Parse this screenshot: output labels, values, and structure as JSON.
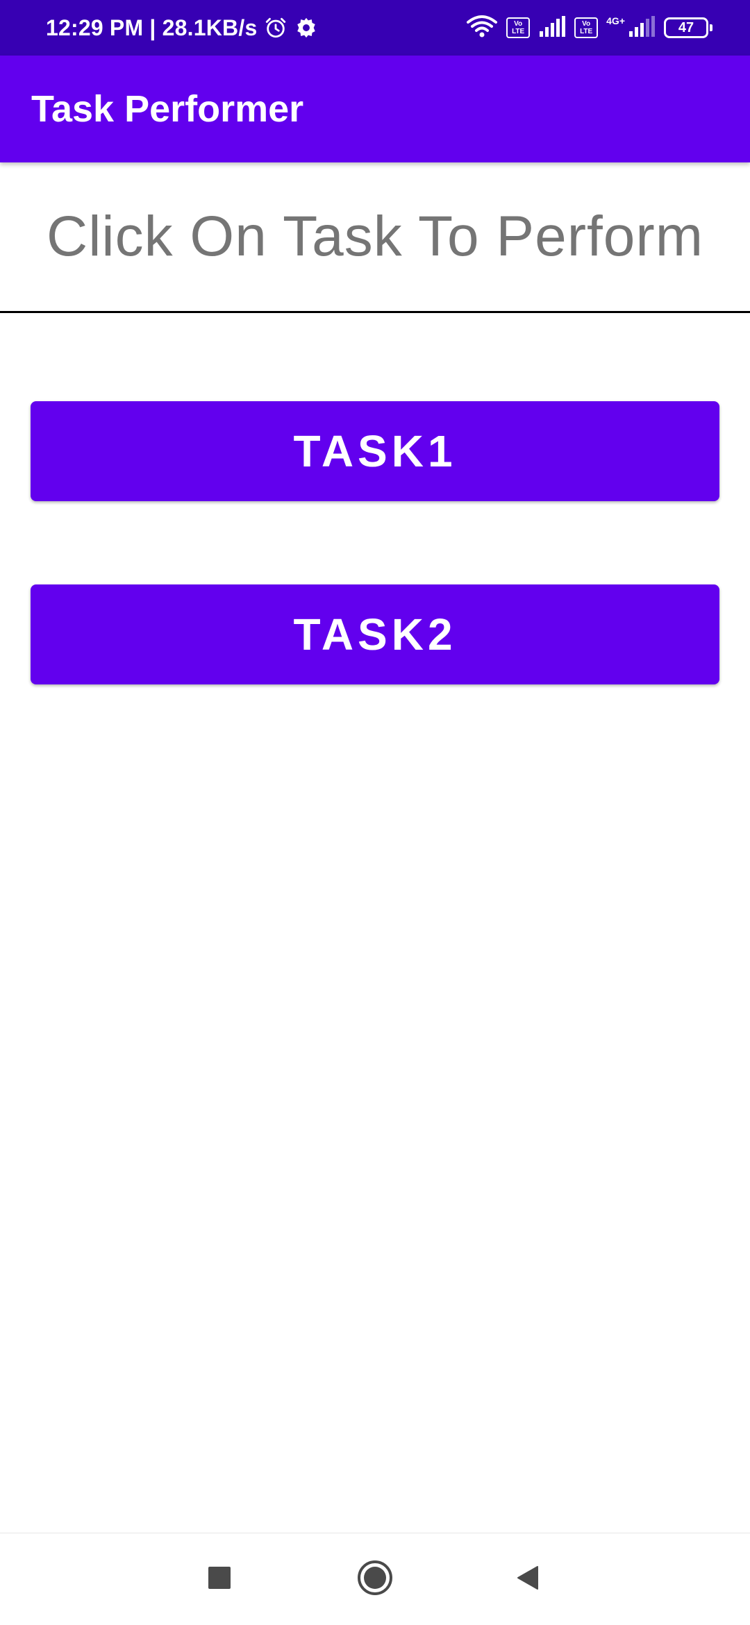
{
  "status_bar": {
    "time_speed": "12:29 PM | 28.1KB/s",
    "volte_label": "Vo LTE",
    "network_type": "4G+",
    "battery_level": "47",
    "icons": [
      "alarm-icon",
      "settings-icon",
      "wifi-icon",
      "volte-icon",
      "signal-icon",
      "battery-icon"
    ],
    "color": "#3700b3"
  },
  "app_bar": {
    "title": "Task Performer",
    "color": "#6200ee"
  },
  "main": {
    "instruction": "Click On Task To Perform",
    "buttons": [
      {
        "label": "TASK1"
      },
      {
        "label": "TASK2"
      }
    ],
    "button_color": "#6200ee",
    "instruction_color": "#757575"
  },
  "nav_bar": {
    "icons": [
      "recents-icon",
      "home-icon",
      "back-icon"
    ]
  }
}
